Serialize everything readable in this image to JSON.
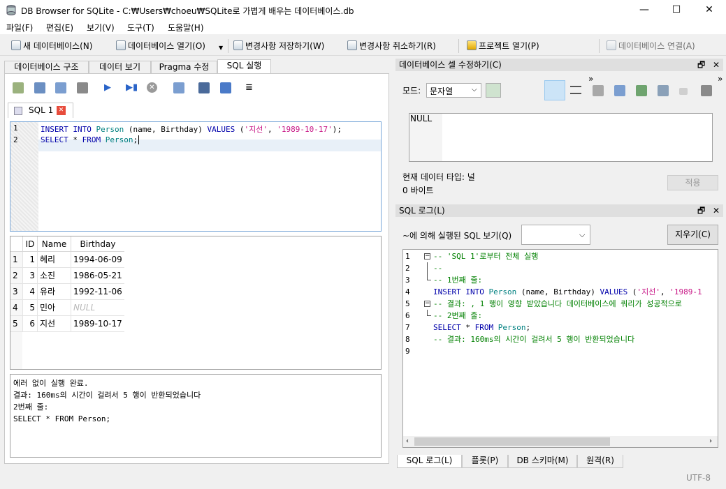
{
  "window": {
    "title": "DB Browser for SQLite - C:₩Users₩choeu₩SQLite로 가볍게 배우는 데이터베이스.db",
    "minimize": "—",
    "maximize": "☐",
    "close": "✕"
  },
  "menu": [
    "파일(F)",
    "편집(E)",
    "보기(V)",
    "도구(T)",
    "도움말(H)"
  ],
  "toolbar": {
    "new_db": "새 데이터베이스(N)",
    "open_db": "데이터베이스 열기(O)",
    "write_changes": "변경사항 저장하기(W)",
    "revert_changes": "변경사항 취소하기(R)",
    "open_project": "프로젝트 열기(P)",
    "attach_db": "데이터베이스 연결(A)",
    "overflow": "»"
  },
  "main_tabs": [
    "데이터베이스 구조",
    "데이터 보기",
    "Pragma 수정",
    "SQL 실행"
  ],
  "sql_tab": {
    "label": "SQL 1",
    "close": "✕"
  },
  "editor": {
    "lines": [
      {
        "num": "1",
        "parts": [
          [
            "kw",
            "INSERT INTO "
          ],
          [
            "id",
            "Person"
          ],
          [
            "pl",
            " ("
          ],
          [
            "pl",
            "name"
          ],
          [
            "pl",
            ", "
          ],
          [
            "pl",
            "Birthday"
          ],
          [
            "pl",
            ") "
          ],
          [
            "kw",
            "VALUES"
          ],
          [
            "pl",
            " ("
          ],
          [
            "str",
            "'지선'"
          ],
          [
            "pl",
            ", "
          ],
          [
            "str",
            "'1989-10-17'"
          ],
          [
            "pl",
            ");"
          ]
        ]
      },
      {
        "num": "2",
        "parts": [
          [
            "kw",
            "SELECT"
          ],
          [
            "pl",
            " * "
          ],
          [
            "kw",
            "FROM "
          ],
          [
            "id",
            "Person"
          ],
          [
            "pl",
            ";"
          ]
        ]
      }
    ]
  },
  "results": {
    "columns": [
      "ID",
      "Name",
      "Birthday"
    ],
    "rows": [
      {
        "n": "1",
        "id": "1",
        "name": "혜리",
        "birthday": "1994-06-09"
      },
      {
        "n": "2",
        "id": "3",
        "name": "소진",
        "birthday": "1986-05-21"
      },
      {
        "n": "3",
        "id": "4",
        "name": "유라",
        "birthday": "1992-11-06"
      },
      {
        "n": "4",
        "id": "5",
        "name": "민아",
        "birthday": "NULL"
      },
      {
        "n": "5",
        "id": "6",
        "name": "지선",
        "birthday": "1989-10-17"
      }
    ]
  },
  "messages": [
    "에러 없이 실행 완료.",
    "결과: 160ms의 시간이 걸려서 5 행이 반환되었습니다",
    "2번째 줄:",
    "SELECT * FROM Person;"
  ],
  "cell_editor": {
    "header": "데이터베이스 셀 수정하기(C)",
    "mode_label": "모드:",
    "mode_value": "문자열",
    "content": "NULL",
    "type_label": "현재 데이터 타입: 널",
    "size_label": "0 바이트",
    "apply": "적용",
    "float_icon": "🗗",
    "close_icon": "✕"
  },
  "sql_log": {
    "header": "SQL 로그(L)",
    "filter_label": "~에 의해 실행된 SQL 보기(Q)",
    "clear": "지우기(C)",
    "lines": [
      {
        "num": "1",
        "fold": "box",
        "parts": [
          [
            "cm",
            "-- 'SQL 1'로부터 전체 실행"
          ]
        ]
      },
      {
        "num": "2",
        "fold": "line",
        "parts": [
          [
            "cm",
            "--"
          ]
        ]
      },
      {
        "num": "3",
        "fold": "end",
        "parts": [
          [
            "cm",
            "-- 1번째 줄:"
          ]
        ]
      },
      {
        "num": "4",
        "fold": "",
        "parts": [
          [
            "kw",
            "INSERT INTO "
          ],
          [
            "id",
            "Person"
          ],
          [
            "pl",
            " (name, Birthday) "
          ],
          [
            "kw",
            "VALUES"
          ],
          [
            "pl",
            " ("
          ],
          [
            "str",
            "'지선'"
          ],
          [
            "pl",
            ", "
          ],
          [
            "str",
            "'1989-1"
          ]
        ]
      },
      {
        "num": "5",
        "fold": "box",
        "parts": [
          [
            "cm",
            "-- 결과: , 1 행이 영향 받았습니다 데이터베이스에 쿼리가 성공적으로"
          ]
        ]
      },
      {
        "num": "6",
        "fold": "end",
        "parts": [
          [
            "cm",
            "-- 2번째 줄:"
          ]
        ]
      },
      {
        "num": "7",
        "fold": "",
        "parts": [
          [
            "kw",
            "SELECT"
          ],
          [
            "pl",
            " * "
          ],
          [
            "kw",
            "FROM "
          ],
          [
            "id",
            "Person"
          ],
          [
            "pl",
            ";"
          ]
        ]
      },
      {
        "num": "8",
        "fold": "",
        "parts": [
          [
            "cm",
            "-- 결과: 160ms의 시간이 걸려서 5 행이 반환되었습니다"
          ]
        ]
      },
      {
        "num": "9",
        "fold": "",
        "parts": []
      }
    ]
  },
  "bottom_tabs": [
    "SQL 로그(L)",
    "플롯(P)",
    "DB 스키마(M)",
    "원격(R)"
  ],
  "status": {
    "encoding": "UTF-8"
  },
  "colors": {
    "annotation_underline": "#e01b1b",
    "keyword": "#0000aa",
    "identifier": "#008080",
    "string": "#c71585",
    "comment": "#008000"
  }
}
